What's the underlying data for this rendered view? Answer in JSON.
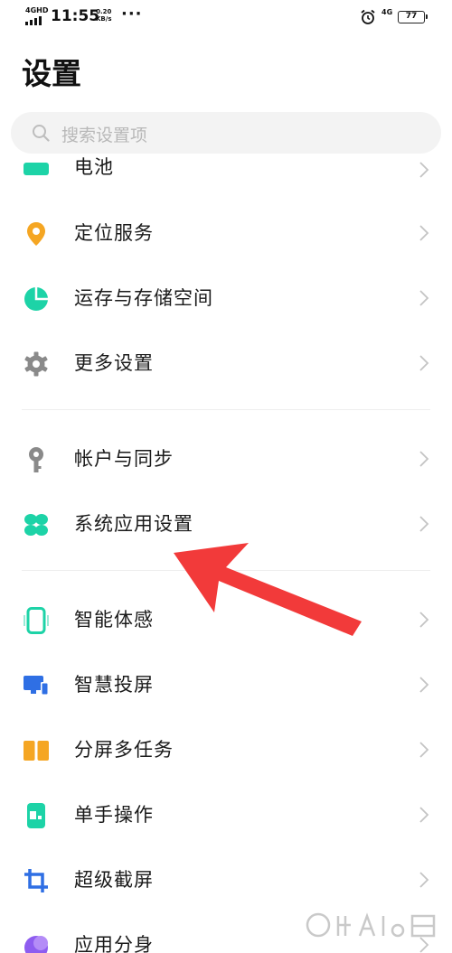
{
  "status_bar": {
    "network_left": "4GHD",
    "time": "11:55",
    "speed_value": "0.20",
    "speed_unit": "KB/s",
    "more_dots": "···",
    "network_right": "4G",
    "battery": "77"
  },
  "header": {
    "title": "设置"
  },
  "search": {
    "placeholder": "搜索设置项"
  },
  "settings_items": [
    {
      "label": "电池",
      "icon": "battery-icon",
      "color": "#1dd3a7"
    },
    {
      "label": "定位服务",
      "icon": "location-icon",
      "color": "#f5a623"
    },
    {
      "label": "运存与存储空间",
      "icon": "storage-icon",
      "color": "#1dd3a7"
    },
    {
      "label": "更多设置",
      "icon": "gear-icon",
      "color": "#8a8a8a"
    },
    {
      "label": "帐户与同步",
      "icon": "key-icon",
      "color": "#8a8a8a"
    },
    {
      "label": "系统应用设置",
      "icon": "apps-icon",
      "color": "#1dd3a7"
    },
    {
      "label": "智能体感",
      "icon": "phone-motion-icon",
      "color": "#1dd3a7"
    },
    {
      "label": "智慧投屏",
      "icon": "screen-cast-icon",
      "color": "#2f6fe4"
    },
    {
      "label": "分屏多任务",
      "icon": "split-screen-icon",
      "color": "#f5a623"
    },
    {
      "label": "单手操作",
      "icon": "one-hand-icon",
      "color": "#1dd3a7"
    },
    {
      "label": "超级截屏",
      "icon": "crop-icon",
      "color": "#2f6fe4"
    },
    {
      "label": "应用分身",
      "icon": "app-clone-icon",
      "color": "#8e5cf0"
    }
  ],
  "colors": {
    "annotation_arrow": "#f23a3a",
    "accent": "#1dd3a7"
  }
}
